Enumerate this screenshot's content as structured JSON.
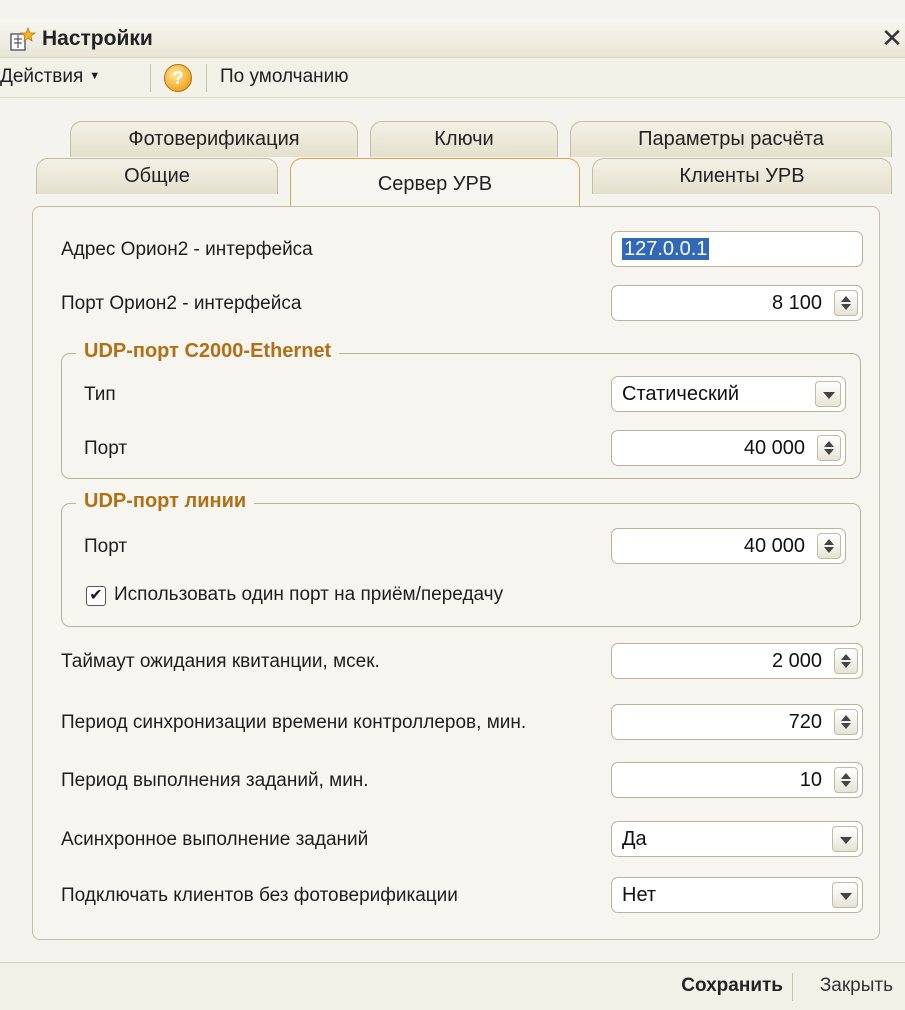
{
  "window": {
    "title": "Настройки",
    "icon": "settings-doc-icon",
    "close": "✕"
  },
  "toolbar": {
    "actions_label": "Действия",
    "help_label": "?",
    "default_label": "По умолчанию"
  },
  "tabs": {
    "row1": [
      "Фотоверификация",
      "Ключи",
      "Параметры расчёта"
    ],
    "row2": [
      "Общие",
      "Сервер УРВ",
      "Клиенты УРВ"
    ],
    "active": "Сервер УРВ"
  },
  "form": {
    "address_label": "Адрес Орион2 - интерфейса",
    "address_value": "127.0.0.1",
    "port_label": "Порт Орион2 - интерфейса",
    "port_value": "8 100",
    "group1": {
      "title": "UDP-порт С2000-Ethernet",
      "type_label": "Тип",
      "type_value": "Статический",
      "port_label": "Порт",
      "port_value": "40 000"
    },
    "group2": {
      "title": "UDP-порт линии",
      "port_label": "Порт",
      "port_value": "40 000",
      "checkbox_label": "Использовать один порт на приём/передачу",
      "checkbox_checked": true
    },
    "timeout_label": "Таймаут ожидания квитанции, мсек.",
    "timeout_value": "2 000",
    "sync_label": "Период синхронизации времени контроллеров, мин.",
    "sync_value": "720",
    "tasks_label": "Период выполнения заданий, мин.",
    "tasks_value": "10",
    "async_label": "Асинхронное выполнение заданий",
    "async_value": "Да",
    "clients_label": "Подключать клиентов без фотоверификации",
    "clients_value": "Нет"
  },
  "footer": {
    "save_label": "Сохранить",
    "close_label": "Закрыть"
  },
  "colors": {
    "accent_orange": "#b07016",
    "selection_blue": "#3268b8"
  }
}
